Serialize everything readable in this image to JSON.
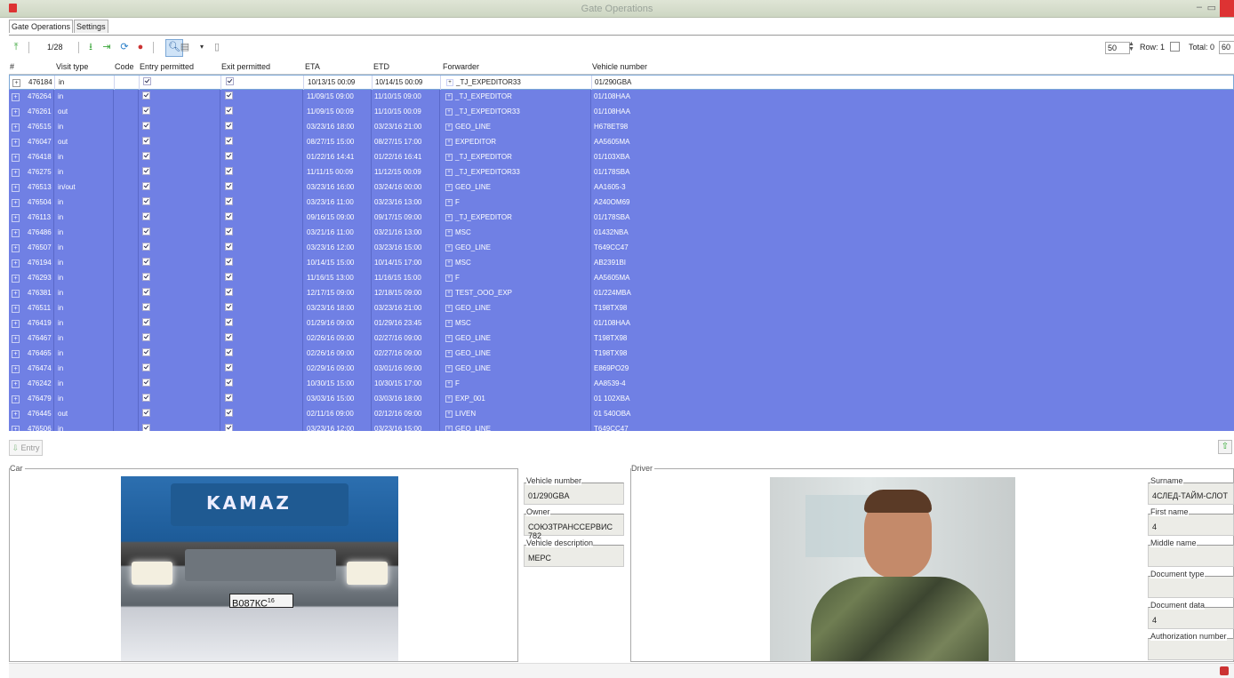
{
  "window": {
    "title": "Gate Operations"
  },
  "tabs": [
    {
      "label": "Gate Operations"
    },
    {
      "label": "Settings"
    }
  ],
  "toolbar": {
    "page": "1/28",
    "page_size": "50",
    "row_label": "Row: 1",
    "total_label": "Total: 0",
    "total_value": "60"
  },
  "grid": {
    "headers": [
      "#",
      "Visit type",
      "Code",
      "Entry permitted",
      "Exit permitted",
      "ETA",
      "ETD",
      "Forwarder",
      "Vehicle number"
    ],
    "rows": [
      {
        "id": "476184",
        "visit": "in",
        "eta": "10/13/15 00:09",
        "etd": "10/14/15 00:09",
        "forwarder": "_TJ_EXPEDITOR33",
        "vehicle": "01/290GBA"
      },
      {
        "id": "476264",
        "visit": "in",
        "eta": "11/09/15 09:00",
        "etd": "11/10/15 09:00",
        "forwarder": "_TJ_EXPEDITOR",
        "vehicle": "01/108HAA"
      },
      {
        "id": "476261",
        "visit": "out",
        "eta": "11/09/15 00:09",
        "etd": "11/10/15 00:09",
        "forwarder": "_TJ_EXPEDITOR33",
        "vehicle": "01/108HAA"
      },
      {
        "id": "476515",
        "visit": "in",
        "eta": "03/23/16 18:00",
        "etd": "03/23/16 21:00",
        "forwarder": "GEO_LINE",
        "vehicle": "H678ET98"
      },
      {
        "id": "476047",
        "visit": "out",
        "eta": "08/27/15 15:00",
        "etd": "08/27/15 17:00",
        "forwarder": "EXPEDITOR",
        "vehicle": "AA5605MA"
      },
      {
        "id": "476418",
        "visit": "in",
        "eta": "01/22/16 14:41",
        "etd": "01/22/16 16:41",
        "forwarder": "_TJ_EXPEDITOR",
        "vehicle": "01/103XBA"
      },
      {
        "id": "476275",
        "visit": "in",
        "eta": "11/11/15 00:09",
        "etd": "11/12/15 00:09",
        "forwarder": "_TJ_EXPEDITOR33",
        "vehicle": "01/178SBA"
      },
      {
        "id": "476513",
        "visit": "in/out",
        "eta": "03/23/16 16:00",
        "etd": "03/24/16 00:00",
        "forwarder": "GEO_LINE",
        "vehicle": "AA1605-3"
      },
      {
        "id": "476504",
        "visit": "in",
        "eta": "03/23/16 11:00",
        "etd": "03/23/16 13:00",
        "forwarder": "F",
        "vehicle": "A240OM69"
      },
      {
        "id": "476113",
        "visit": "in",
        "eta": "09/16/15 09:00",
        "etd": "09/17/15 09:00",
        "forwarder": "_TJ_EXPEDITOR",
        "vehicle": "01/178SBA"
      },
      {
        "id": "476486",
        "visit": "in",
        "eta": "03/21/16 11:00",
        "etd": "03/21/16 13:00",
        "forwarder": "MSC",
        "vehicle": "01432NBA"
      },
      {
        "id": "476507",
        "visit": "in",
        "eta": "03/23/16 12:00",
        "etd": "03/23/16 15:00",
        "forwarder": "GEO_LINE",
        "vehicle": "T649CC47"
      },
      {
        "id": "476194",
        "visit": "in",
        "eta": "10/14/15 15:00",
        "etd": "10/14/15 17:00",
        "forwarder": "MSC",
        "vehicle": "AB2391BI"
      },
      {
        "id": "476293",
        "visit": "in",
        "eta": "11/16/15 13:00",
        "etd": "11/16/15 15:00",
        "forwarder": "F",
        "vehicle": "AA5605MA"
      },
      {
        "id": "476381",
        "visit": "in",
        "eta": "12/17/15 09:00",
        "etd": "12/18/15 09:00",
        "forwarder": "TEST_OOO_EXP",
        "vehicle": "01/224MBA"
      },
      {
        "id": "476511",
        "visit": "in",
        "eta": "03/23/16 18:00",
        "etd": "03/23/16 21:00",
        "forwarder": "GEO_LINE",
        "vehicle": "T198TX98"
      },
      {
        "id": "476419",
        "visit": "in",
        "eta": "01/29/16 09:00",
        "etd": "01/29/16 23:45",
        "forwarder": "MSC",
        "vehicle": "01/108HAA"
      },
      {
        "id": "476467",
        "visit": "in",
        "eta": "02/26/16 09:00",
        "etd": "02/27/16 09:00",
        "forwarder": "GEO_LINE",
        "vehicle": "T198TX98"
      },
      {
        "id": "476465",
        "visit": "in",
        "eta": "02/26/16 09:00",
        "etd": "02/27/16 09:00",
        "forwarder": "GEO_LINE",
        "vehicle": "T198TX98"
      },
      {
        "id": "476474",
        "visit": "in",
        "eta": "02/29/16 09:00",
        "etd": "03/01/16 09:00",
        "forwarder": "GEO_LINE",
        "vehicle": "E869PO29"
      },
      {
        "id": "476242",
        "visit": "in",
        "eta": "10/30/15 15:00",
        "etd": "10/30/15 17:00",
        "forwarder": "F",
        "vehicle": "AA8539-4"
      },
      {
        "id": "476479",
        "visit": "in",
        "eta": "03/03/16 15:00",
        "etd": "03/03/16 18:00",
        "forwarder": "EXP_001",
        "vehicle": "01 102XBA"
      },
      {
        "id": "476445",
        "visit": "out",
        "eta": "02/11/16 09:00",
        "etd": "02/12/16 09:00",
        "forwarder": "LIVEN",
        "vehicle": "01 540OBA"
      },
      {
        "id": "476506",
        "visit": "in",
        "eta": "03/23/16 12:00",
        "etd": "03/23/16 15:00",
        "forwarder": "GEO_LINE",
        "vehicle": "T649CC47"
      }
    ]
  },
  "entry_button": "Entry",
  "car": {
    "group_label": "Car",
    "vehicle_number_label": "Vehicle number",
    "vehicle_number": "01/290GBA",
    "owner_label": "Owner",
    "owner": "СОЮЗТРАНССЕРВИС 782",
    "description_label": "Vehicle description",
    "description": "МЕРС",
    "photo_brand": "KAMAZ",
    "photo_plate": "В087КС",
    "photo_plate_region": "16"
  },
  "driver": {
    "group_label": "Driver",
    "surname_label": "Surname",
    "surname": "4СЛЕД-ТАЙМ-СЛОТ",
    "first_name_label": "First name",
    "first_name": "4",
    "middle_name_label": "Middle name",
    "middle_name": "",
    "doc_type_label": "Document type",
    "doc_type": "",
    "doc_data_label": "Document data",
    "doc_data": "4",
    "auth_number_label": "Authorization number",
    "auth_number": ""
  },
  "colors": {
    "selection": "#7080e4",
    "accent_green": "#3aa53a"
  }
}
